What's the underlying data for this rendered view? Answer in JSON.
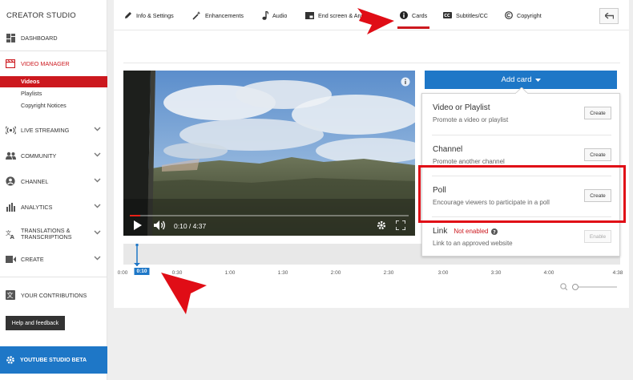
{
  "sidebar": {
    "title": "CREATOR STUDIO",
    "dashboard": "DASHBOARD",
    "video_manager": "VIDEO MANAGER",
    "sub_items": [
      "Videos",
      "Playlists",
      "Copyright Notices"
    ],
    "live_streaming": "LIVE STREAMING",
    "community": "COMMUNITY",
    "channel": "CHANNEL",
    "analytics": "ANALYTICS",
    "translations_line1": "TRANSLATIONS &",
    "translations_line2": "TRANSCRIPTIONS",
    "create": "CREATE",
    "your_contributions": "YOUR CONTRIBUTIONS",
    "help": "Help and feedback",
    "beta": "YOUTUBE STUDIO BETA"
  },
  "tabs": [
    "Info & Settings",
    "Enhancements",
    "Audio",
    "End screen & Anno",
    "Cards",
    "Subtitles/CC",
    "Copyright"
  ],
  "player": {
    "time": "0:10 / 4:37",
    "progress": 0.036
  },
  "timeline": {
    "ticks": [
      "0:00",
      "0:30",
      "1:00",
      "1:30",
      "2:00",
      "2:30",
      "3:00",
      "3:30",
      "4:00",
      "4:38"
    ],
    "current": "0:10"
  },
  "cards": {
    "add_label": "Add card",
    "items": [
      {
        "title": "Video or Playlist",
        "desc": "Promote a video or playlist",
        "button": "Create"
      },
      {
        "title": "Channel",
        "desc": "Promote another channel",
        "button": "Create"
      },
      {
        "title": "Poll",
        "desc": "Encourage viewers to participate in a poll",
        "button": "Create"
      },
      {
        "title": "Link",
        "status": "Not enabled",
        "desc": "Link to an approved website",
        "button": "Enable"
      }
    ]
  },
  "colors": {
    "accent_red": "#cc181e",
    "accent_blue": "#1e77c7",
    "annotation_red": "#e00d16"
  }
}
